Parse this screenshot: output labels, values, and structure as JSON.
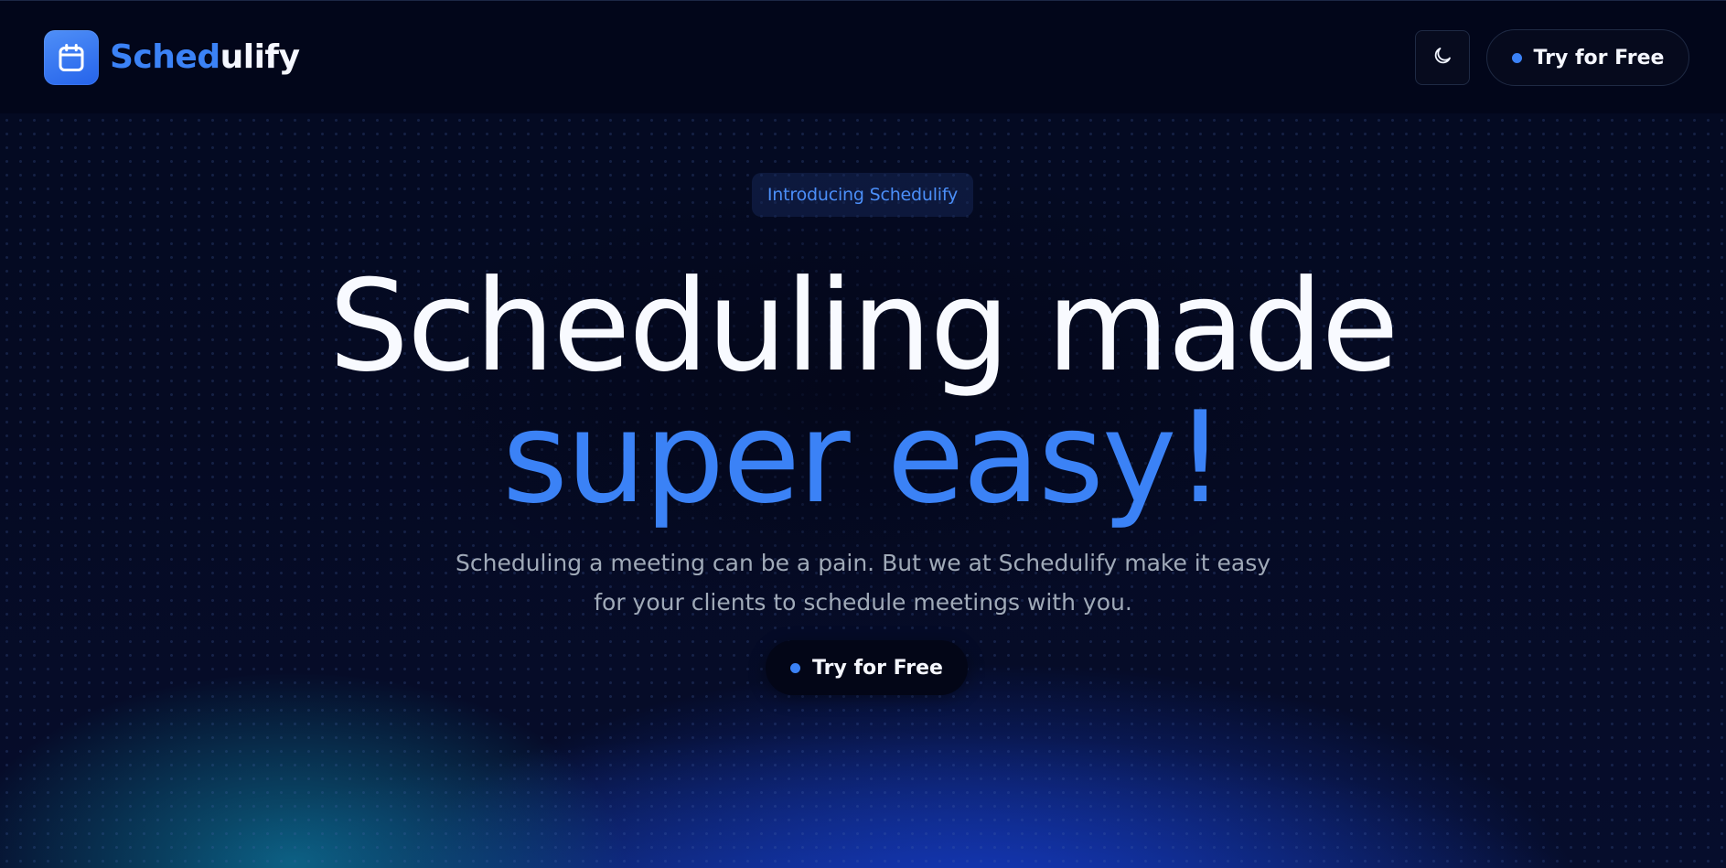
{
  "navbar": {
    "logo_icon": "calendar-icon",
    "logo_text_accent": "Sched",
    "logo_text_rest": "ulify",
    "theme_icon": "moon-icon",
    "cta_label": "Try for Free"
  },
  "hero": {
    "badge": "Introducing Schedulify",
    "headline_line1": "Scheduling made",
    "headline_line2": "super easy!",
    "subtitle_line1": "Scheduling a meeting can be a pain. But we at Schedulify make it easy",
    "subtitle_line2": "for your clients to schedule meetings with you.",
    "cta_label": "Try for Free"
  },
  "colors": {
    "accent": "#3b82f6",
    "background": "#030617",
    "text_muted": "#a0aab8"
  }
}
